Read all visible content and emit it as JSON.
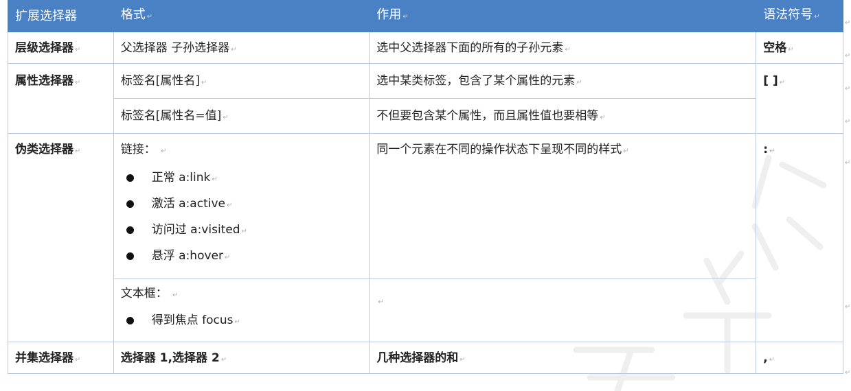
{
  "header": {
    "col1": "扩展选择器",
    "col2": "格式",
    "col3": "作用",
    "col4": "语法符号"
  },
  "rows": {
    "hier": {
      "name": "层级选择器",
      "format": "父选择器 子孙选择器",
      "effect": "选中父选择器下面的所有的子孙元素",
      "symbol": "空格"
    },
    "attr": {
      "name": "属性选择器",
      "format1": "标签名[属性名]",
      "effect1": "选中某类标签，包含了某个属性的元素",
      "format2": "标签名[属性名=值]",
      "effect2": "不但要包含某个属性，而且属性值也要相等",
      "symbol": "[ ]"
    },
    "pseudo": {
      "name": "伪类选择器",
      "link_heading": "链接：",
      "link_items": [
        "正常  a:link",
        "激活  a:active",
        "访问过  a:visited",
        "悬浮  a:hover"
      ],
      "effect": "同一个元素在不同的操作状态下呈现不同的样式",
      "textbox_heading": "文本框：",
      "textbox_items": [
        "得到焦点  focus"
      ],
      "symbol": ":"
    },
    "union": {
      "name": "并集选择器",
      "format": "选择器 1,选择器 2",
      "effect": "几种选择器的和",
      "symbol": ","
    }
  },
  "paragraph_mark": "↵",
  "colors": {
    "header_bg": "#4a80c4",
    "border": "#b9c9df"
  }
}
